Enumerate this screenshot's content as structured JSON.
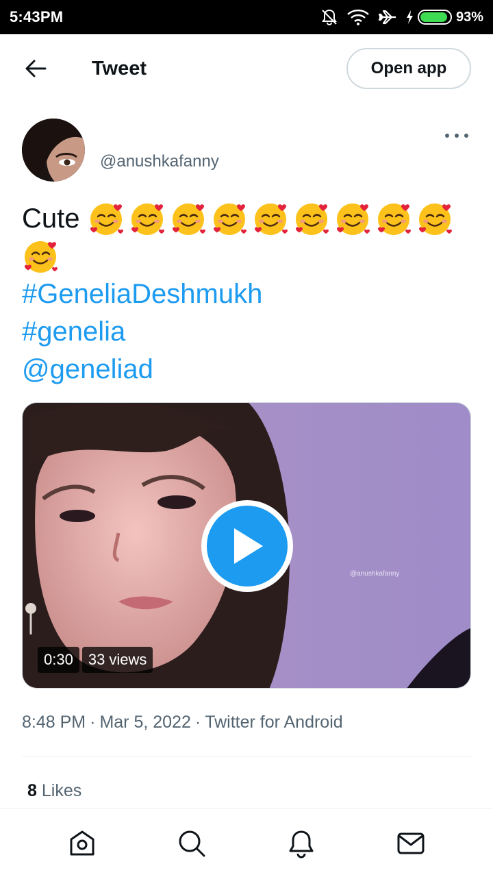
{
  "status_bar": {
    "time": "5:43PM",
    "battery_percent": "93%",
    "battery_level": 0.93,
    "icons": [
      "notifications-off-icon",
      "wifi-icon",
      "airplane-icon",
      "charging-icon",
      "battery-icon"
    ]
  },
  "header": {
    "back_icon": "arrow-left-icon",
    "title": "Tweet",
    "open_app_label": "Open app"
  },
  "author": {
    "handle": "@anushkafanny",
    "more_icon": "more-horizontal-icon"
  },
  "tweet": {
    "text_word": "Cute",
    "emoji_name": "smiling-face-with-hearts",
    "emoji_count": 10,
    "links": [
      "#GeneliaDeshmukh",
      "#genelia",
      "@geneliad"
    ]
  },
  "media": {
    "watermark": "@anushkafanny",
    "duration": "0:30",
    "views": "33 views",
    "play_icon": "play-icon"
  },
  "meta": {
    "time": "8:48 PM",
    "date": "Mar 5, 2022",
    "source": "Twitter for Android",
    "separator": "·"
  },
  "stats": {
    "likes_count": "8",
    "likes_label": "Likes"
  },
  "bottom_nav": [
    {
      "name": "home",
      "icon": "home-icon"
    },
    {
      "name": "search",
      "icon": "search-icon"
    },
    {
      "name": "notifications",
      "icon": "bell-icon"
    },
    {
      "name": "messages",
      "icon": "mail-icon"
    }
  ],
  "colors": {
    "accent": "#1d9bf0",
    "text_primary": "#0f1419",
    "text_secondary": "#536471",
    "border": "#cfd9de"
  }
}
